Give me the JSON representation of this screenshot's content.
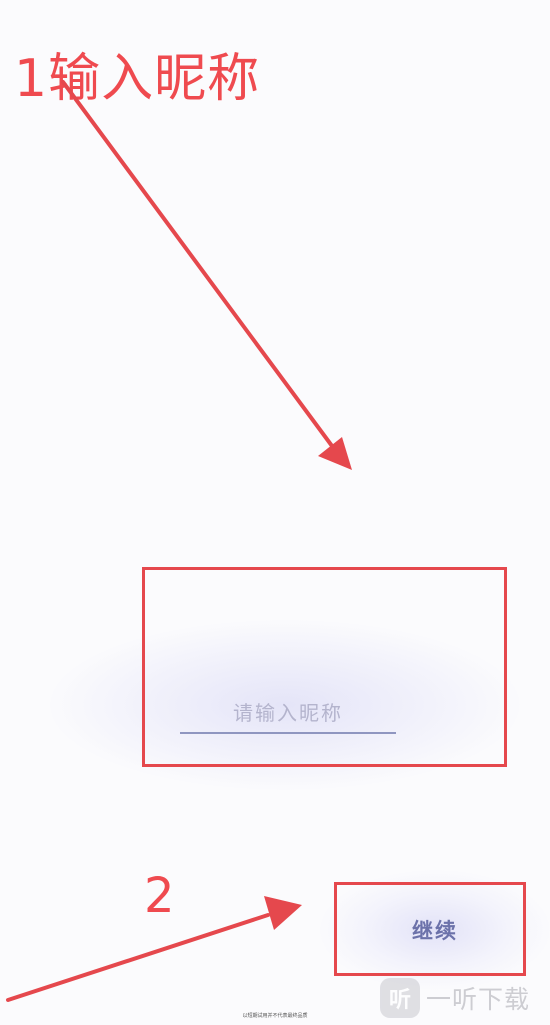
{
  "annotations": {
    "step1_label": "1输入昵称",
    "step2_label": "2",
    "color": "#e5484d"
  },
  "nickname_field": {
    "placeholder": "请输入昵称",
    "value": ""
  },
  "continue_button": {
    "label": "继续"
  },
  "footer": {
    "note": "以短期试用并不代表最终品质"
  },
  "watermark": {
    "logo_glyph": "听",
    "text": "一听下载"
  },
  "icons": {
    "arrow": "arrow-icon"
  }
}
